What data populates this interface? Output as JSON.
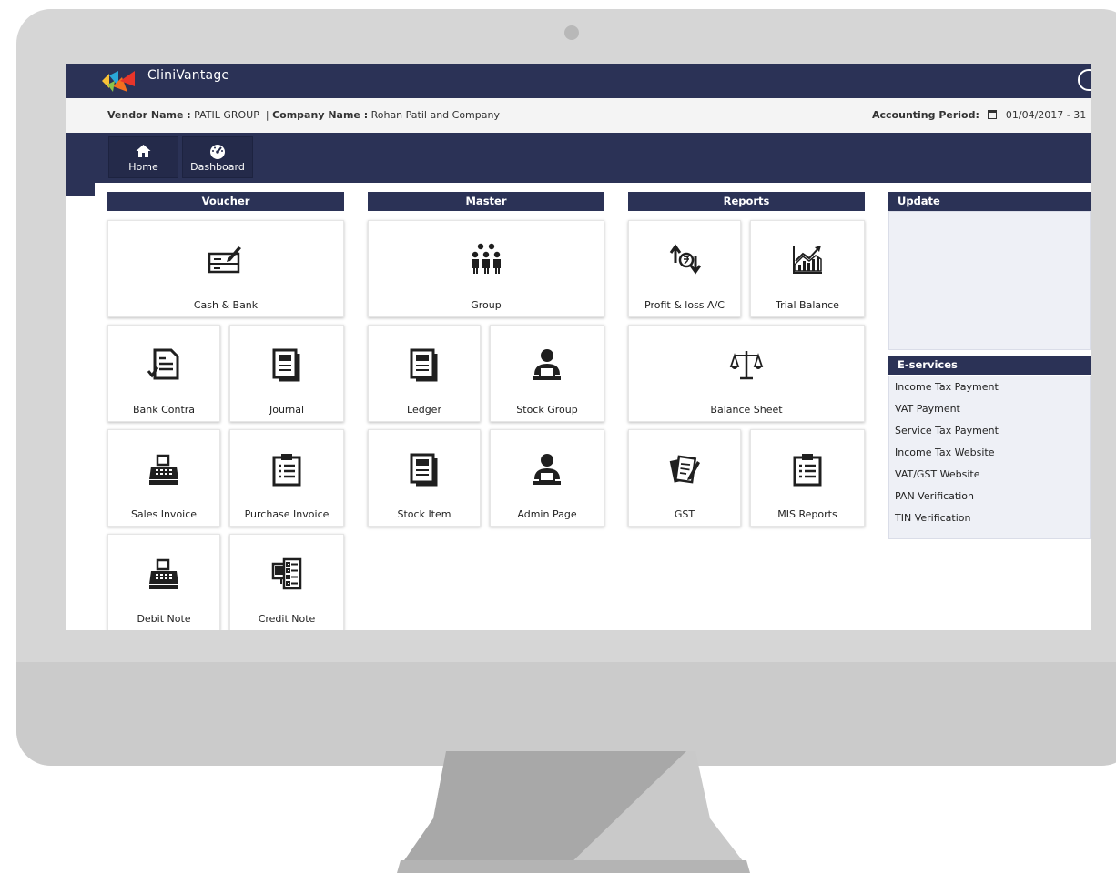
{
  "app": {
    "name": "CliniVantage"
  },
  "info": {
    "vendor_label": "Vendor Name :",
    "vendor_value": "PATIL GROUP",
    "separator": "|",
    "company_label": "Company Name :",
    "company_value": "Rohan Patil and Company",
    "period_label": "Accounting Period:",
    "period_value": "01/04/2017 - 31"
  },
  "nav": [
    {
      "label": "Home",
      "icon": "home-icon"
    },
    {
      "label": "Dashboard",
      "icon": "dashboard-icon"
    }
  ],
  "sections": {
    "voucher": "Voucher",
    "master": "Master",
    "reports": "Reports",
    "update": "Update",
    "eservices": "E-services"
  },
  "tiles": {
    "cash_bank": "Cash & Bank",
    "bank_contra": "Bank Contra",
    "journal": "Journal",
    "sales_invoice": "Sales Invoice",
    "purchase_invoice": "Purchase Invoice",
    "debit_note": "Debit Note",
    "credit_note": "Credit Note",
    "group": "Group",
    "ledger": "Ledger",
    "stock_group": "Stock Group",
    "stock_item": "Stock Item",
    "admin_page": "Admin Page",
    "profit_loss": "Profit & loss A/C",
    "trial_balance": "Trial Balance",
    "balance_sheet": "Balance Sheet",
    "gst": "GST",
    "mis_reports": "MIS Reports"
  },
  "eservices_links": [
    "Income Tax Payment",
    "VAT Payment",
    "Service Tax Payment",
    "Income Tax Website",
    "VAT/GST Website",
    "PAN Verification",
    "TIN Verification"
  ],
  "colors": {
    "navy": "#2b3256",
    "panel": "#eef0f6",
    "background": "#ffffff"
  }
}
